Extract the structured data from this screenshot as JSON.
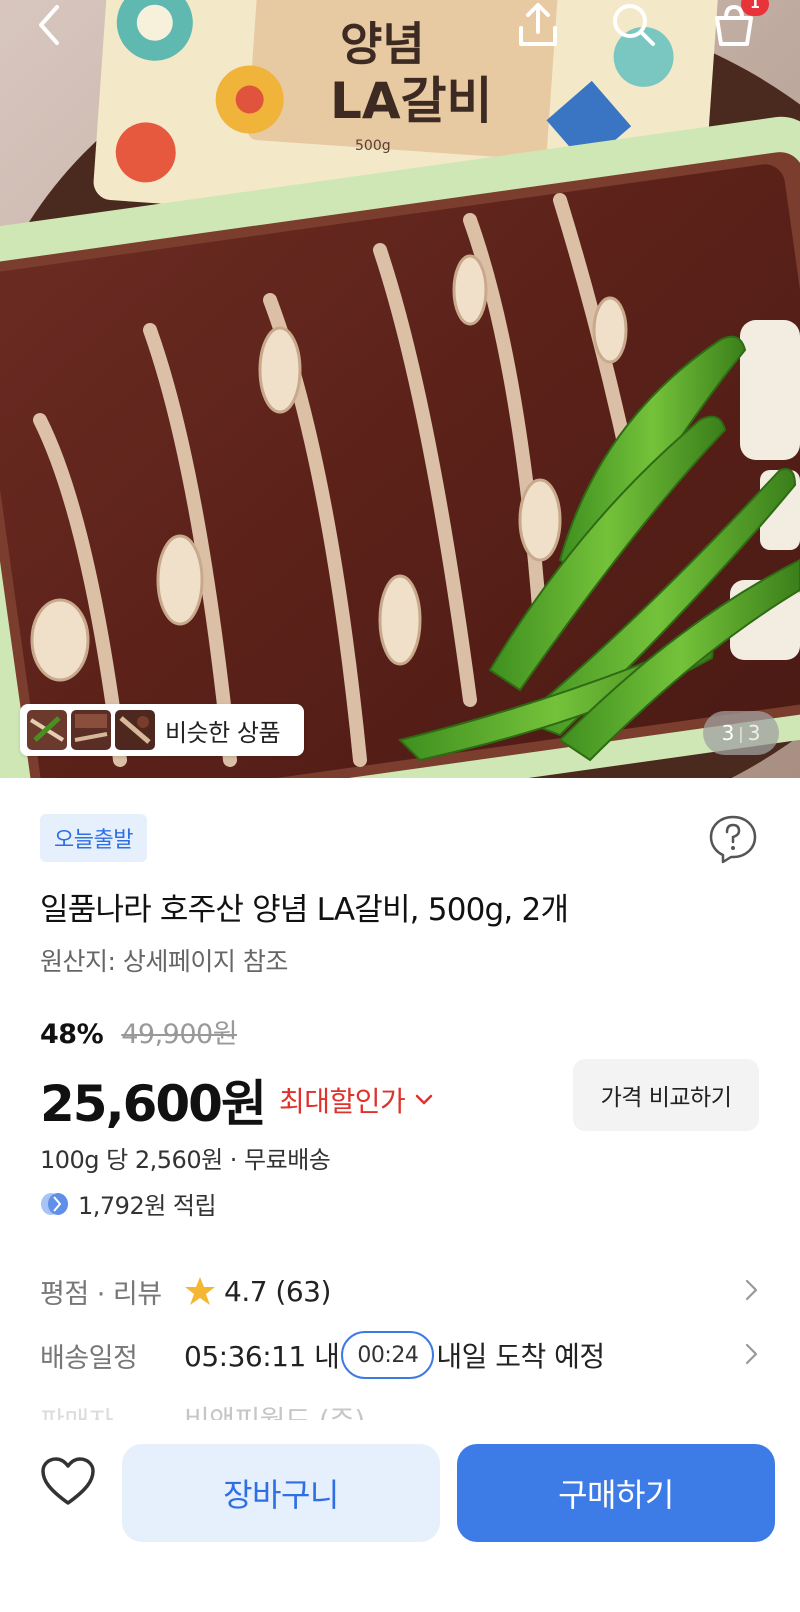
{
  "header": {
    "back_icon": "chevron-left-icon",
    "share_icon": "share-icon",
    "search_icon": "search-icon",
    "cart_icon": "cart-icon",
    "cart_count": "1"
  },
  "gallery": {
    "packaging_text_1": "양념",
    "packaging_text_2": "LA갈비",
    "packaging_small": "500g",
    "similar_label": "비슷한 상품",
    "current_page": "3",
    "total_pages": "3"
  },
  "product": {
    "badge": "오늘출발",
    "title": "일품나라 호주산 양념 LA갈비, 500g, 2개",
    "origin": "원산지: 상세페이지 참조",
    "discount_rate": "48%",
    "original_price": "49,900원",
    "sale_price": "25,600원",
    "max_discount_label": "최대할인가",
    "compare_button": "가격 비교하기",
    "unit_info": "100g 당 2,560원 · 무료배송",
    "reward_points": "1,792원 적립"
  },
  "info_rows": {
    "rating_key": "평점 · 리뷰",
    "rating_value": "4.7 (63)",
    "delivery_key": "배송일정",
    "delivery_timer": "05:36:11 내",
    "delivery_bubble": "00:24",
    "delivery_text": "내일 도착 예정",
    "seller_key": "판매자",
    "seller_value": "비앤피월드 (주)"
  },
  "bottom_bar": {
    "wishlist_icon": "heart-icon",
    "cart_button": "장바구니",
    "buy_button": "구매하기"
  },
  "colors": {
    "accent_blue": "#3d7be6",
    "badge_bg": "#e6f0fd",
    "discount_red": "#e0322c",
    "cart_badge_red": "#e8333a"
  }
}
